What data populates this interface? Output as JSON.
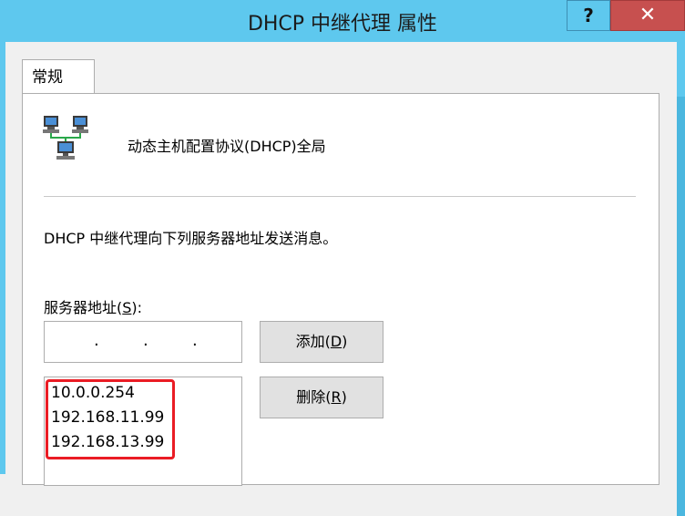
{
  "window": {
    "title": "DHCP 中继代理 属性",
    "help_label": "?",
    "close_label": "✕"
  },
  "tabs": [
    {
      "label": "常规"
    }
  ],
  "general": {
    "description": "动态主机配置协议(DHCP)全局",
    "info_text": "DHCP 中继代理向下列服务器地址发送消息。",
    "server_label_prefix": "服务器地址(",
    "server_label_key": "S",
    "server_label_suffix": "):",
    "ip_input": {
      "value": "",
      "dots": [
        ".",
        ".",
        "."
      ]
    },
    "add_button": {
      "prefix": "添加(",
      "key": "D",
      "suffix": ")"
    },
    "delete_button": {
      "prefix": "删除(",
      "key": "R",
      "suffix": ")"
    },
    "server_addresses": [
      "10.0.0.254",
      "192.168.11.99",
      "192.168.13.99"
    ]
  },
  "colors": {
    "titlebar": "#5ec8ee",
    "close_button": "#c7504f",
    "annotation_box": "#ea1c24"
  },
  "icons": {
    "app": "network-computers-icon",
    "help": "help-icon",
    "close": "close-icon"
  }
}
